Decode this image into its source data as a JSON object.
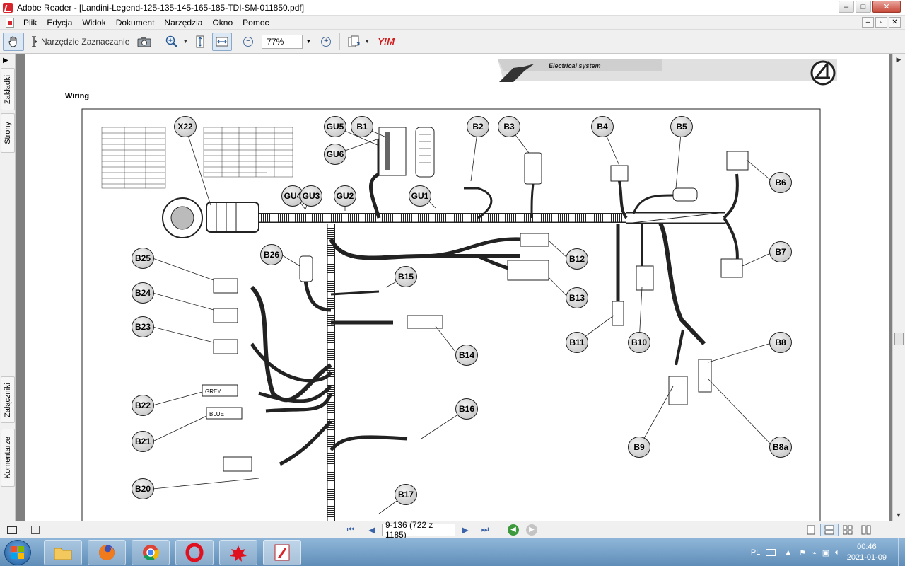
{
  "window": {
    "title": "Adobe Reader - [Landini-Legend-125-135-145-165-185-TDI-SM-011850.pdf]",
    "controls": [
      "–",
      "□",
      "✕"
    ]
  },
  "menu": {
    "items": [
      "Plik",
      "Edycja",
      "Widok",
      "Dokument",
      "Narzędzia",
      "Okno",
      "Pomoc"
    ],
    "mdi_controls": [
      "–",
      "▫",
      "✕"
    ]
  },
  "toolbar": {
    "select_tool_label": "Narzędzie Zaznaczanie",
    "zoom_value": "77%"
  },
  "side_tabs": {
    "top": [
      "Zakładki",
      "Strony"
    ],
    "bottom": [
      "Załączniki",
      "Komentarze"
    ]
  },
  "document": {
    "header_text": "Electrical system",
    "section_title": "Wiring",
    "labels": {
      "x22": "X22",
      "gu5": "GU5",
      "gu6": "GU6",
      "b1": "B1",
      "b2": "B2",
      "b3": "B3",
      "b4": "B4",
      "b5": "B5",
      "b6": "B6",
      "b7": "B7",
      "gu4": "GU4",
      "gu3": "GU3",
      "gu2": "GU2",
      "gu1": "GU1",
      "b26": "B26",
      "b25": "B25",
      "b24": "B24",
      "b23": "B23",
      "b15": "B15",
      "b12": "B12",
      "b13": "B13",
      "b14": "B14",
      "b11": "B11",
      "b10": "B10",
      "b8": "B8",
      "b22": "B22",
      "b21": "B21",
      "b9": "B9",
      "b8a": "B8a",
      "b16": "B16",
      "b20": "B20",
      "b17": "B17"
    },
    "connector_texts": {
      "grey": "GREY",
      "blue": "BLUE"
    }
  },
  "status": {
    "page_display": "9-136  (722 z 1185)"
  },
  "taskbar": {
    "language": "PL",
    "time": "00:46",
    "date": "2021-01-09"
  },
  "colors": {
    "accent": "#d8242c",
    "page_bg": "#808080",
    "taskbar": "#6d98c2"
  }
}
